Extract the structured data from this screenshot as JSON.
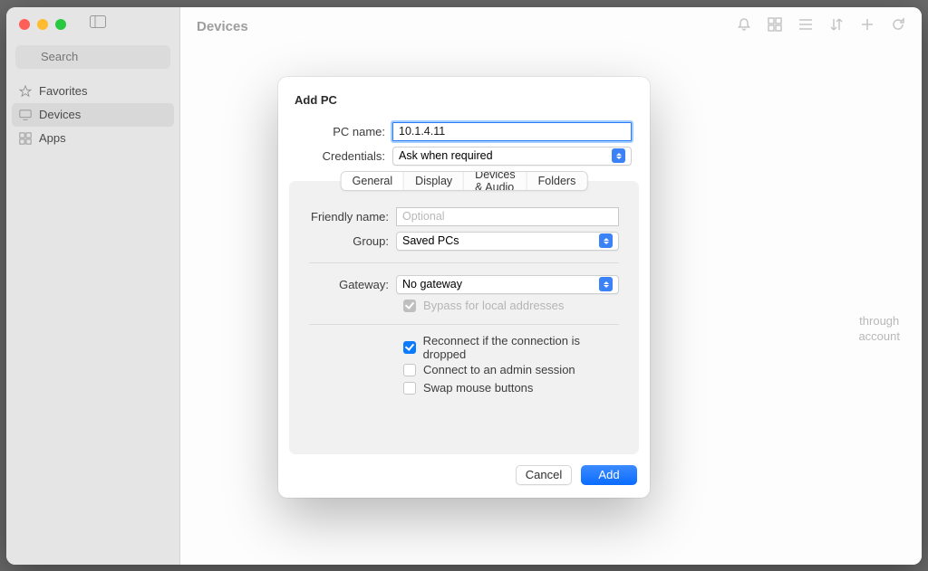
{
  "window": {
    "title": "Devices"
  },
  "sidebar": {
    "search_placeholder": "Search",
    "items": [
      {
        "label": "Favorites",
        "icon": "star-icon",
        "selected": false
      },
      {
        "label": "Devices",
        "icon": "monitor-icon",
        "selected": true
      },
      {
        "label": "Apps",
        "icon": "grid-icon",
        "selected": false
      }
    ]
  },
  "background_hint": {
    "line1": "through",
    "line2": "account"
  },
  "modal": {
    "title": "Add PC",
    "fields": {
      "pc_name_label": "PC name:",
      "pc_name_value": "10.1.4.11",
      "credentials_label": "Credentials:",
      "credentials_value": "Ask when required"
    },
    "tabs": [
      "General",
      "Display",
      "Devices & Audio",
      "Folders"
    ],
    "active_tab": 0,
    "general": {
      "friendly_label": "Friendly name:",
      "friendly_placeholder": "Optional",
      "friendly_value": "",
      "group_label": "Group:",
      "group_value": "Saved PCs",
      "gateway_label": "Gateway:",
      "gateway_value": "No gateway",
      "bypass_label": "Bypass for local addresses",
      "bypass_checked": true,
      "bypass_enabled": false,
      "reconnect_label": "Reconnect if the connection is dropped",
      "reconnect_checked": true,
      "admin_label": "Connect to an admin session",
      "admin_checked": false,
      "swap_label": "Swap mouse buttons",
      "swap_checked": false
    },
    "buttons": {
      "cancel": "Cancel",
      "add": "Add"
    }
  }
}
